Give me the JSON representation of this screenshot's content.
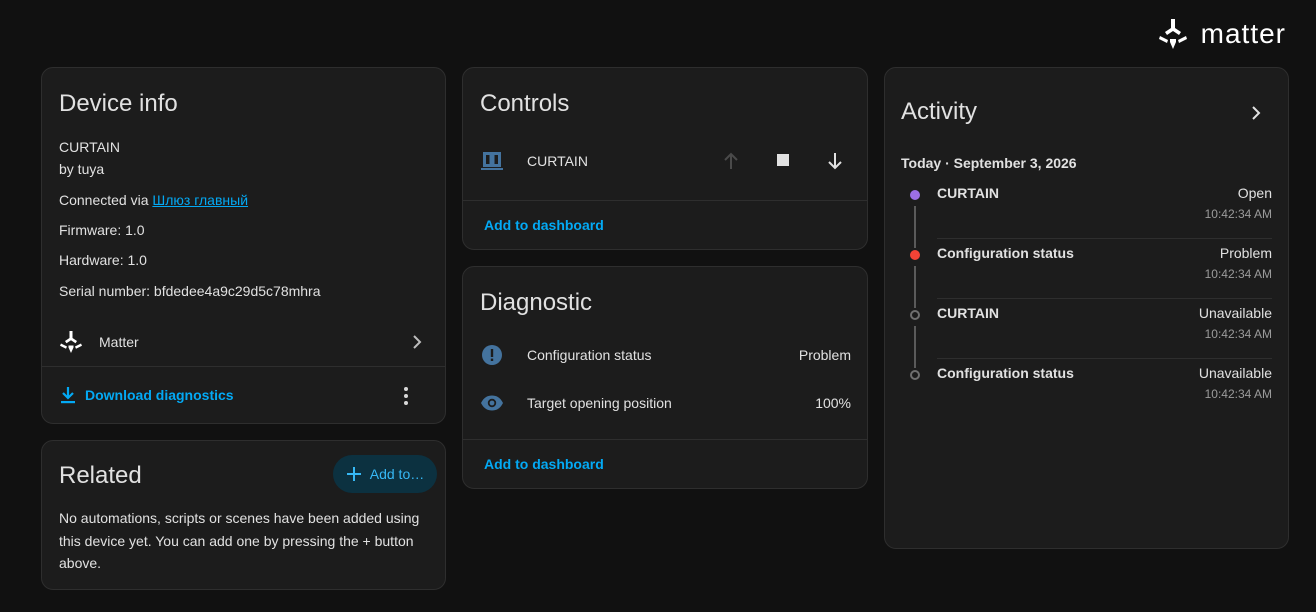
{
  "brand": {
    "name": "matter"
  },
  "device_info": {
    "title": "Device info",
    "model": "CURTAIN",
    "manufacturer": "by tuya",
    "connected_prefix": "Connected via ",
    "connected_link": "Шлюз главный",
    "firmware": "Firmware: 1.0",
    "hardware": "Hardware: 1.0",
    "serial": "Serial number: bfdedee4a9c29d5c78mhra",
    "integration": "Matter",
    "download_label": "Download diagnostics"
  },
  "related": {
    "title": "Related",
    "add_button": "Add to…",
    "message": "No automations, scripts or scenes have been added using this device yet. You can add one by pressing the + button above."
  },
  "controls": {
    "title": "Controls",
    "entity": "CURTAIN",
    "add_dashboard": "Add to dashboard"
  },
  "diagnostic": {
    "title": "Diagnostic",
    "rows": [
      {
        "label": "Configuration status",
        "value": "Problem",
        "icon": "alert-circle-icon"
      },
      {
        "label": "Target opening position",
        "value": "100%",
        "icon": "eye-icon"
      }
    ],
    "add_dashboard": "Add to dashboard"
  },
  "activity": {
    "title": "Activity",
    "date": "Today · September 3, 2026",
    "events": [
      {
        "name": "CURTAIN",
        "state": "Open",
        "time": "10:42:34 AM",
        "color": "#9c6fe4",
        "filled": true
      },
      {
        "name": "Configuration status",
        "state": "Problem",
        "time": "10:42:34 AM",
        "color": "#f44336",
        "filled": true
      },
      {
        "name": "CURTAIN",
        "state": "Unavailable",
        "time": "10:42:34 AM",
        "color": "#6f6f6f",
        "filled": false
      },
      {
        "name": "Configuration status",
        "state": "Unavailable",
        "time": "10:42:34 AM",
        "color": "#6f6f6f",
        "filled": false
      }
    ]
  },
  "colors": {
    "accent": "#03a9f4",
    "background": "#111111",
    "card": "#1c1c1c",
    "icon_blue": "#44739e"
  }
}
